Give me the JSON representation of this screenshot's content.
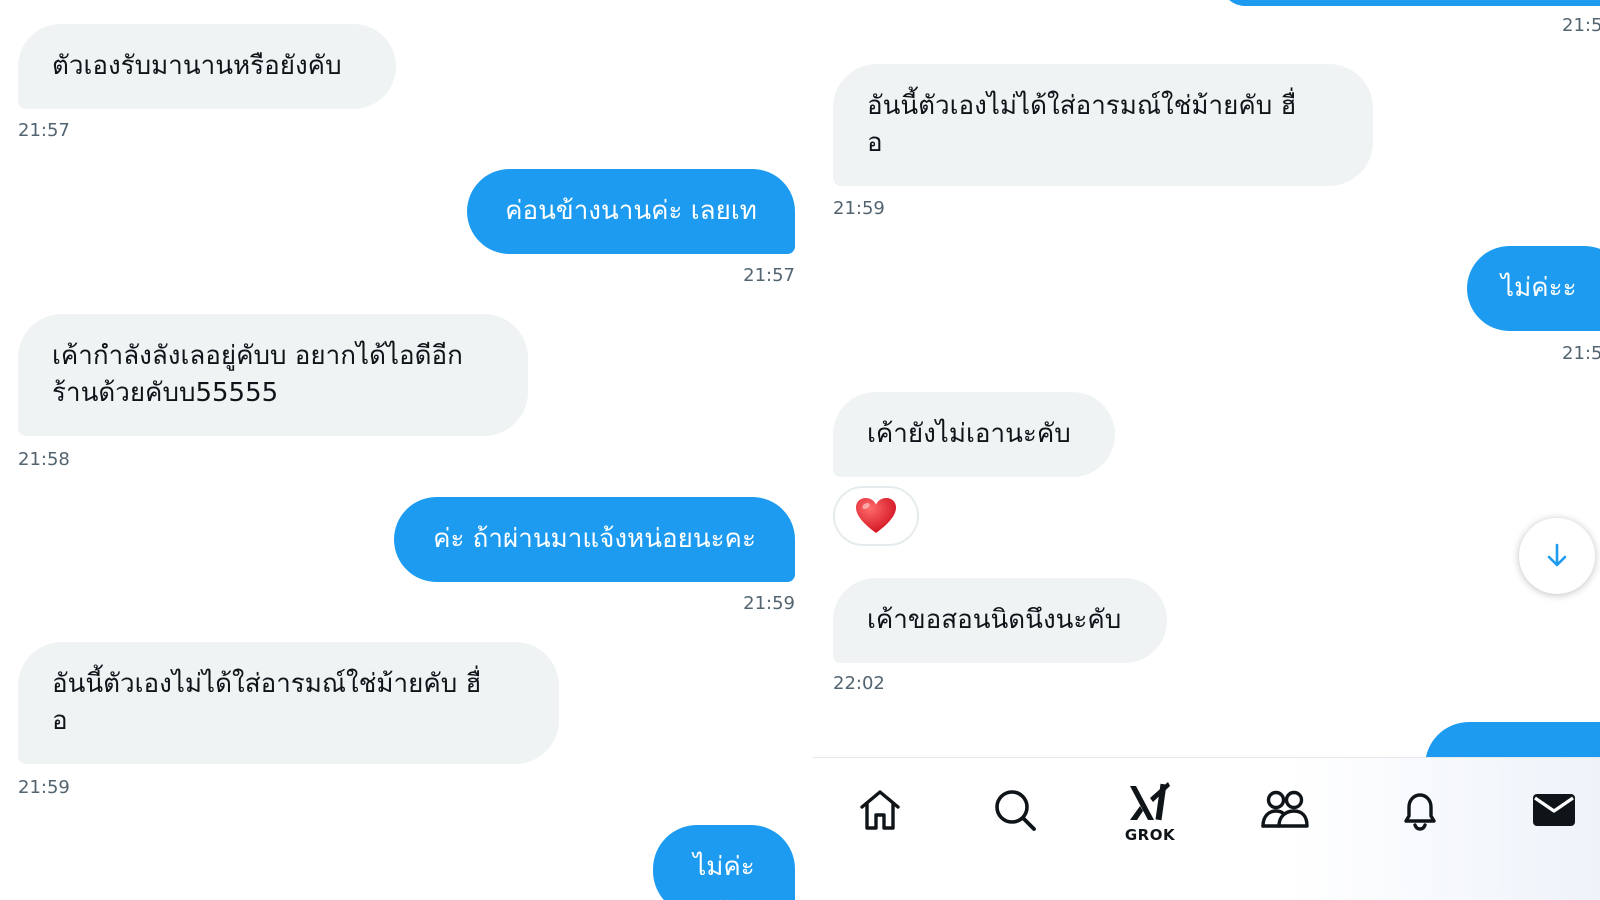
{
  "left": {
    "messages": [
      {
        "dir": "in",
        "text": "ตัวเองรับมานานหรือยังคับ",
        "time": "21:57"
      },
      {
        "dir": "out",
        "text": "ค่อนข้างนานค่ะ เลยเท",
        "time": "21:57"
      },
      {
        "dir": "in",
        "text": "เค้ากำลังลังเลอยู่คับบ อยากได้ไอดีอีก\nร้านด้วยคับบ55555",
        "time": "21:58"
      },
      {
        "dir": "out",
        "text": "ค่ะ ถ้าผ่านมาแจ้งหน่อยนะคะ",
        "time": "21:59"
      },
      {
        "dir": "in",
        "text": "อันนี้ตัวเองไม่ได้ใส่อารมณ์ใช่ม้ายคับ ฮื่\nอ",
        "time": "21:59"
      },
      {
        "dir": "out",
        "text": "ไม่ค่ะะ"
      }
    ]
  },
  "right": {
    "top_time": "21:5",
    "messages": [
      {
        "dir": "in",
        "text": "อันนี้ตัวเองไม่ได้ใส่อารมณ์ใช่ม้ายคับ ฮื่\nอ",
        "time": "21:59"
      },
      {
        "dir": "out",
        "text": "ไม่ค่ะะ",
        "time": "21:5"
      },
      {
        "dir": "in",
        "text": "เค้ายังไม่เอานะคับ"
      },
      {
        "dir": "in",
        "text": "เค้าขอสอนนิดนึงนะคับ",
        "time": "22:02"
      }
    ],
    "reaction": "heart",
    "scroll_button_icon": "arrow-down-icon"
  },
  "navbar": {
    "items": [
      {
        "name": "home",
        "icon": "home-icon"
      },
      {
        "name": "search",
        "icon": "search-icon"
      },
      {
        "name": "grok",
        "icon": "grok-icon",
        "label": "GROK"
      },
      {
        "name": "communities",
        "icon": "people-icon"
      },
      {
        "name": "notifications",
        "icon": "bell-icon"
      },
      {
        "name": "messages",
        "icon": "mail-icon"
      }
    ]
  },
  "colors": {
    "outgoing_bubble": "#1d9bf0",
    "incoming_bubble": "#eff3f4",
    "timestamp": "#536471",
    "text": "#0f1419"
  }
}
